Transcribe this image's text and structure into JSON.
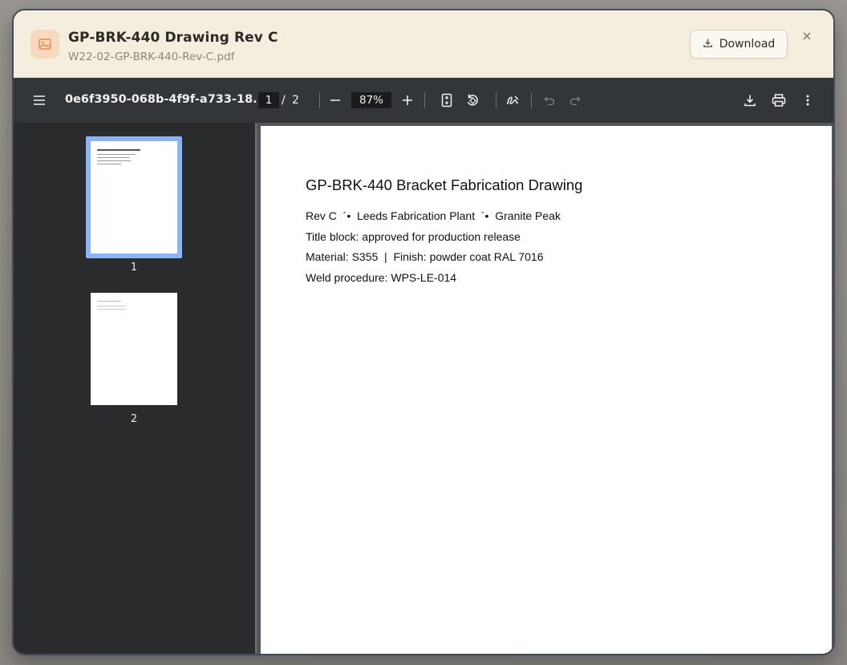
{
  "modal": {
    "title": "GP-BRK-440 Drawing Rev C",
    "filename": "W22-02-GP-BRK-440-Rev-C.pdf",
    "download_label": "Download",
    "file_icon": "image-file-icon",
    "close_icon": "close-icon"
  },
  "viewer": {
    "doc_name": "0e6f3950-068b-4f9f-a733-18...",
    "current_page": "1",
    "page_separator": "/",
    "total_pages": "2",
    "zoom": "87%",
    "icons": [
      "menu-icon",
      "zoom-out-icon",
      "zoom-in-icon",
      "fit-page-icon",
      "rotate-icon",
      "annotate-icon",
      "undo-icon",
      "redo-icon",
      "download-icon",
      "print-icon",
      "more-icon"
    ]
  },
  "thumbnails": [
    {
      "label": "1",
      "selected": true
    },
    {
      "label": "2",
      "selected": false
    }
  ],
  "document": {
    "heading": "GP-BRK-440 Bracket Fabrication Drawing",
    "lines": [
      "Rev C  ´•  Leeds Fabrication Plant  ´•  Granite Peak",
      "Title block: approved for production release",
      "Material: S355  |  Finish: powder coat RAL 7016",
      "Weld procedure: WPS-LE-014"
    ]
  },
  "colors": {
    "modal_bg": "#f5eedf",
    "toolbar_bg": "#323639",
    "sidebar_bg": "#2a2b2d",
    "selected_thumb": "#8ab4f8",
    "file_badge": "#f6d9bf",
    "file_icon_accent": "#e8874a"
  }
}
